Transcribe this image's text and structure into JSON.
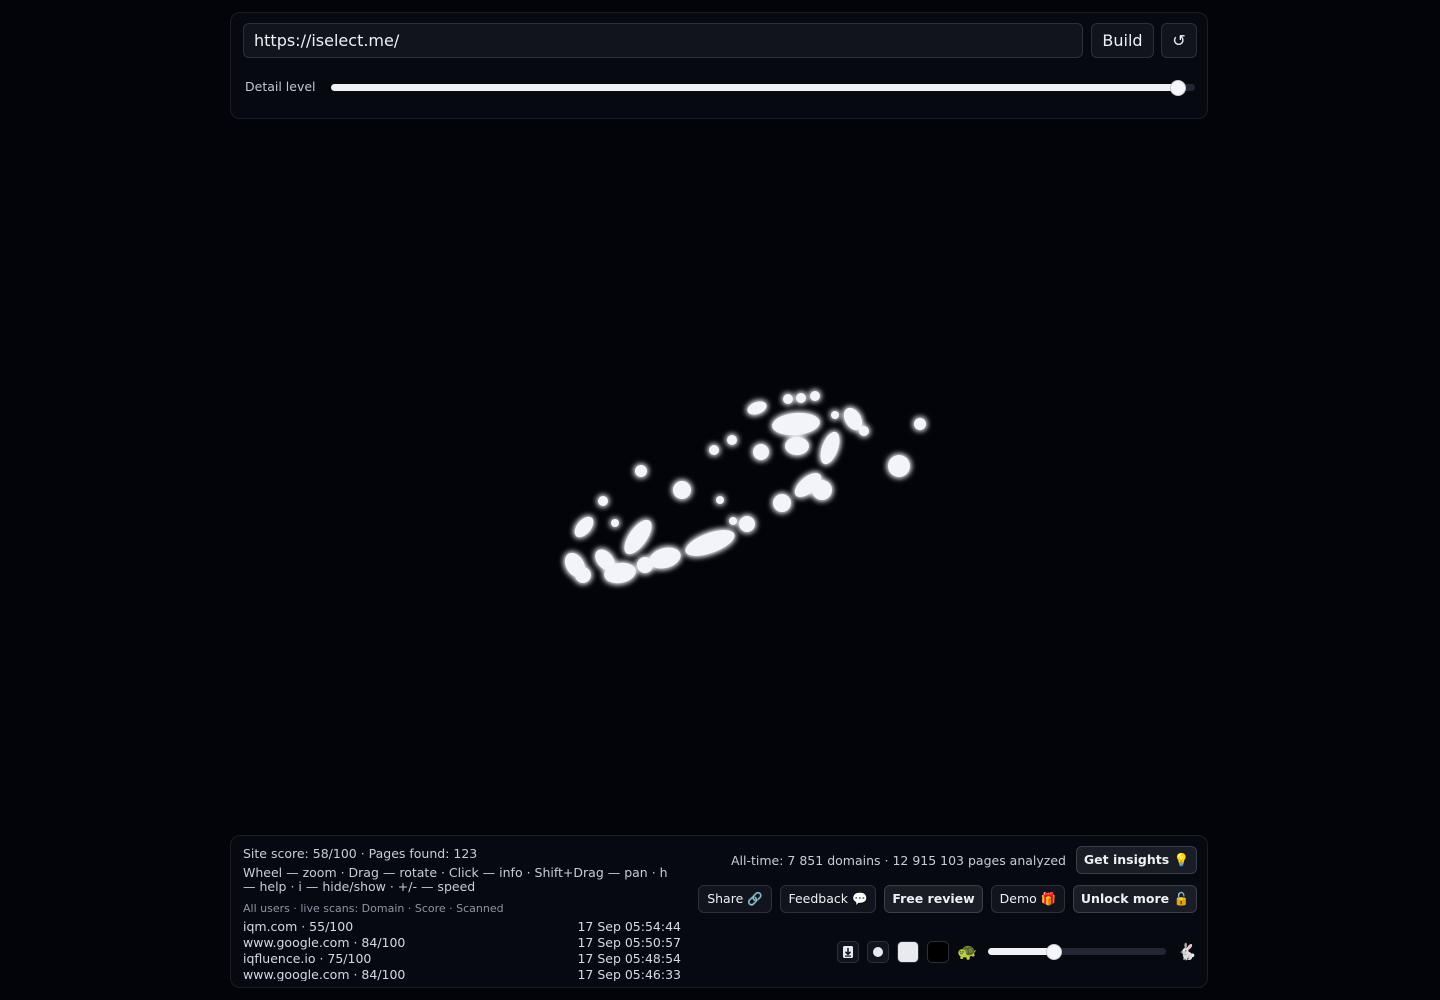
{
  "top": {
    "url_value": "https://iselect.me/",
    "build_label": "Build",
    "reset_label": "↺",
    "detail_label": "Detail level",
    "detail_level": 0.98
  },
  "bottom": {
    "site_stats": "Site score: 58/100 · Pages found: 123",
    "help": "Wheel — zoom · Drag — rotate · Click — info · Shift+Drag — pan · h — help · i — hide/show · +/- — speed",
    "feed_header": "All users · live scans: Domain · Score · Scanned",
    "feed": [
      {
        "domain": "iqm.com · 55/100",
        "time": "17 Sep 05:54:44"
      },
      {
        "domain": "www.google.com · 84/100",
        "time": "17 Sep 05:50:57"
      },
      {
        "domain": "iqfluence.io · 75/100",
        "time": "17 Sep 05:48:54"
      },
      {
        "domain": "www.google.com · 84/100",
        "time": "17 Sep 05:46:33"
      }
    ],
    "alltime": "All-time: 7 851 domains · 12 915 103 pages analyzed",
    "insights_label": "Get insights 💡",
    "share_label": "Share 🔗",
    "feedback_label": "Feedback 💬",
    "free_review_label": "Free review",
    "demo_label": "Demo 🎁",
    "unlock_label": "Unlock more 🔓",
    "speed_level": 0.37,
    "icons": [
      "export-icon",
      "dot-small-icon",
      "dot-large-icon",
      "dark-square-icon",
      "turtle-icon",
      "rabbit-icon"
    ]
  }
}
